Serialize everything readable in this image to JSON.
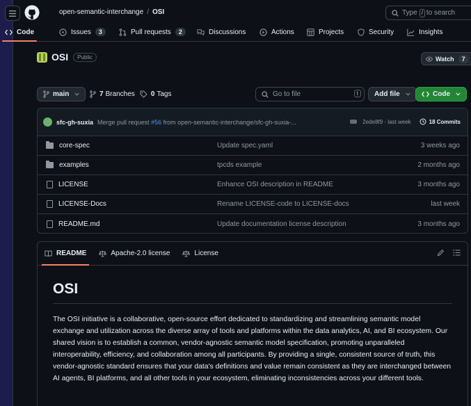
{
  "header": {
    "org": "open-semantic-interchange",
    "separator": "/",
    "repo": "OSI",
    "search": {
      "prefix": "Type",
      "key": "/",
      "suffix": "to search"
    }
  },
  "nav_tabs": [
    {
      "label": "Code",
      "icon": "code-icon",
      "active": true
    },
    {
      "label": "Issues",
      "icon": "issue-icon",
      "count": "3"
    },
    {
      "label": "Pull requests",
      "icon": "pull-request-icon",
      "count": "2"
    },
    {
      "label": "Discussions",
      "icon": "discussions-icon"
    },
    {
      "label": "Actions",
      "icon": "play-icon"
    },
    {
      "label": "Projects",
      "icon": "table-icon"
    },
    {
      "label": "Security",
      "icon": "shield-icon"
    },
    {
      "label": "Insights",
      "icon": "graph-icon"
    }
  ],
  "repo": {
    "name": "OSI",
    "visibility": "Public",
    "watch_label": "Watch",
    "watch_count": "7"
  },
  "toolbar": {
    "branch": "main",
    "branches_count": "7",
    "branches_label": "Branches",
    "tags_count": "0",
    "tags_label": "Tags",
    "goto_placeholder": "Go to file",
    "goto_key": "t",
    "add_file": "Add file",
    "code_button": "Code"
  },
  "latest_commit": {
    "user": "sfc-gh-suxia",
    "message_prefix": "Merge pull request",
    "pr": "#56",
    "message_suffix": "from open-semantic-interchange/sfc-gh-suxia-...",
    "hash_time": "2ede8f9 · last week",
    "commits_label": "18 Commits"
  },
  "files": [
    {
      "type": "folder",
      "name": "core-spec",
      "message": "Update spec.yaml",
      "time": "3 weeks ago"
    },
    {
      "type": "folder",
      "name": "examples",
      "message": "tpcds example",
      "time": "2 months ago"
    },
    {
      "type": "file",
      "name": "LICENSE",
      "message": "Enhance OSI description in README",
      "time": "3 months ago"
    },
    {
      "type": "file",
      "name": "LICENSE-Docs",
      "message": "Rename LICENSE-code to LICENSE-docs",
      "time": "last week"
    },
    {
      "type": "file",
      "name": "README.md",
      "message": "Update documentation license description",
      "time": "3 months ago"
    }
  ],
  "readme_tabs": [
    {
      "label": "README",
      "icon": "book-icon",
      "active": true
    },
    {
      "label": "Apache-2.0 license",
      "icon": "law-icon"
    },
    {
      "label": "License",
      "icon": "law-icon"
    }
  ],
  "readme": {
    "title": "OSI",
    "body": "The OSI initiative is a collaborative, open-source effort dedicated to standardizing and streamlining semantic model exchange and utilization across the diverse array of tools and platforms within the data analytics, AI, and BI ecosystem. Our shared vision is to establish a common, vendor-agnostic semantic model specification, promoting unparalleled interoperability, efficiency, and collaboration among all participants. By providing a single, consistent source of truth, this vendor-agnostic standard ensures that your data's definitions and value remain consistent as they are interchanged between AI agents, BI platforms, and all other tools in your ecosystem, eliminating inconsistencies across your different tools."
  },
  "colors": {
    "background": "#0d1117",
    "accent_tab": "#f78166",
    "link": "#4493f8",
    "green_button": "#238636"
  }
}
